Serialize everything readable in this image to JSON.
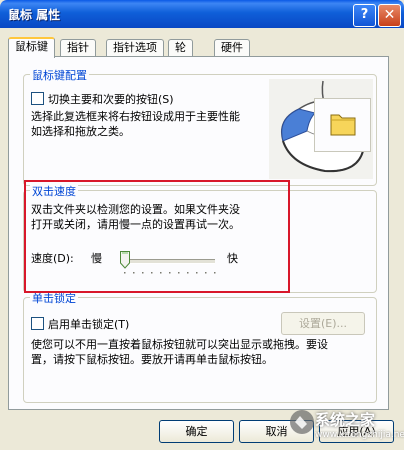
{
  "window": {
    "title": "鼠标 属性",
    "help_button": "?",
    "close_button": "✕"
  },
  "tabs": [
    {
      "label": "鼠标键",
      "active": true
    },
    {
      "label": "指针",
      "active": false
    },
    {
      "label": "指针选项",
      "active": false
    },
    {
      "label": "轮",
      "active": false
    },
    {
      "label": "硬件",
      "active": false
    }
  ],
  "button_config": {
    "legend": "鼠标键配置",
    "swap_checkbox_label": "切换主要和次要的按钮(S)",
    "swap_checked": false,
    "description_line1": "选择此复选框来将右按钮设成用于主要性能",
    "description_line2": "如选择和拖放之类。"
  },
  "double_click": {
    "legend": "双击速度",
    "description_line1": "双击文件夹以检测您的设置。如果文件夹没",
    "description_line2": "打开或关闭，请用慢一点的设置再试一次。",
    "speed_label": "速度(D):",
    "slow_label": "慢",
    "fast_label": "快",
    "speed_value": 0.05
  },
  "click_lock": {
    "legend": "单击锁定",
    "checkbox_label": "启用单击锁定(T)",
    "checked": false,
    "settings_button": "设置(E)...",
    "description_line1": "使您可以不用一直按着鼠标按钮就可以突出显示或拖拽。要设",
    "description_line2": "置，请按下鼠标按钮。要放开请再单击鼠标按钮。"
  },
  "footer": {
    "ok_button": "确定",
    "cancel_button": "取消",
    "apply_button": "应用(A)"
  },
  "watermark": {
    "text": "系统之家",
    "subtext": "www.xitongzhijia.net"
  },
  "colors": {
    "title_bar": "#0a59e6",
    "group_legend": "#0046d5",
    "highlight_box": "#d8172a",
    "tab_active_accent": "#ffc73c"
  }
}
